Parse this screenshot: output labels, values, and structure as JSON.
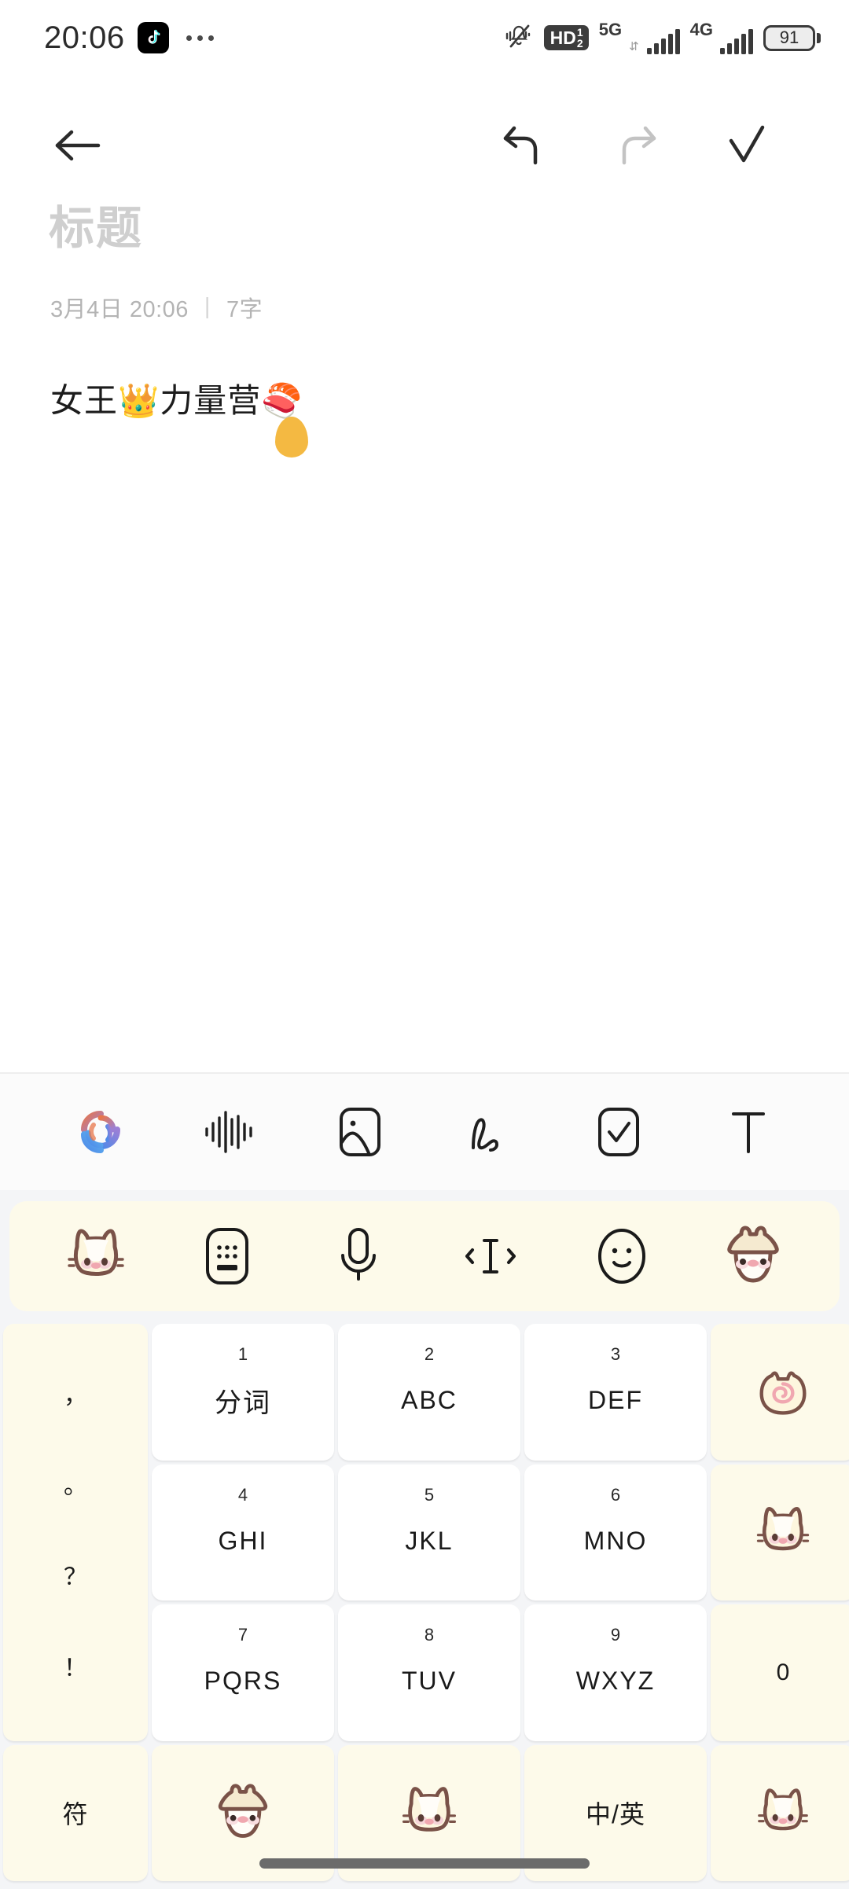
{
  "status_bar": {
    "time": "20:06",
    "app_badge_icon": "tiktok-icon",
    "overflow_icon": "more-dots-icon",
    "mute_icon": "mute-vibrate-icon",
    "hd_label": "HD",
    "hd_sub_top": "1",
    "hd_sub_bottom": "2",
    "network_primary": "5G",
    "network_secondary": "4G",
    "data_arrows_icon": "data-transfer-icon",
    "battery_level": "91"
  },
  "appbar": {
    "back_icon": "back-arrow-icon",
    "undo_icon": "undo-arrow-icon",
    "redo_icon": "redo-arrow-icon",
    "done_icon": "checkmark-icon",
    "undo_enabled": true,
    "redo_enabled": false
  },
  "note": {
    "title_placeholder": "标题",
    "date": "3月4日 20:06",
    "separator": "|",
    "word_count": "7字",
    "body_text": "女王👑力量营🍣"
  },
  "note_tools": [
    {
      "name": "ai-assistant-icon",
      "label": "AI"
    },
    {
      "name": "voice-waveform-icon",
      "label": "语音"
    },
    {
      "name": "image-icon",
      "label": "图片"
    },
    {
      "name": "handwriting-icon",
      "label": "手写"
    },
    {
      "name": "checklist-icon",
      "label": "待办"
    },
    {
      "name": "text-format-icon",
      "label": "T"
    }
  ],
  "keyboard": {
    "toolbar": [
      {
        "name": "mascot-cat-icon"
      },
      {
        "name": "keyboard-switch-icon"
      },
      {
        "name": "microphone-icon"
      },
      {
        "name": "cursor-move-icon"
      },
      {
        "name": "emoji-smiley-icon"
      },
      {
        "name": "mascot-hat-icon"
      }
    ],
    "punctuation_key": [
      "，",
      "。",
      "？",
      "！"
    ],
    "rows": [
      [
        {
          "num": "1",
          "alpha": "分词",
          "type": "cn",
          "key_name": "key-1-fenci"
        },
        {
          "num": "2",
          "alpha": "ABC",
          "type": "alpha",
          "key_name": "key-2-abc"
        },
        {
          "num": "3",
          "alpha": "DEF",
          "type": "alpha",
          "key_name": "key-3-def"
        }
      ],
      [
        {
          "num": "4",
          "alpha": "GHI",
          "type": "alpha",
          "key_name": "key-4-ghi"
        },
        {
          "num": "5",
          "alpha": "JKL",
          "type": "alpha",
          "key_name": "key-5-jkl"
        },
        {
          "num": "6",
          "alpha": "MNO",
          "type": "alpha",
          "key_name": "key-6-mno"
        }
      ],
      [
        {
          "num": "7",
          "alpha": "PQRS",
          "type": "alpha",
          "key_name": "key-7-pqrs"
        },
        {
          "num": "8",
          "alpha": "TUV",
          "type": "alpha",
          "key_name": "key-8-tuv"
        },
        {
          "num": "9",
          "alpha": "WXYZ",
          "type": "alpha",
          "key_name": "key-9-wxyz"
        }
      ]
    ],
    "right_column": [
      {
        "name": "backspace-mascot-icon",
        "label": ""
      },
      {
        "name": "clear-mascot-icon",
        "label": ""
      },
      {
        "name": "key-0",
        "label": "0"
      }
    ],
    "bottom_row": [
      {
        "name": "symbols-key",
        "label": "符"
      },
      {
        "name": "mascot-hat-key",
        "label": ""
      },
      {
        "name": "space-mascot-key",
        "label": ""
      },
      {
        "name": "lang-toggle-key",
        "label": "中/英"
      },
      {
        "name": "enter-mascot-key",
        "label": ""
      }
    ]
  },
  "colors": {
    "keyboard_bg": "#f4f5f7",
    "key_cream": "#fdfaea",
    "key_white": "#ffffff",
    "mascot_outline": "#7a5248",
    "mascot_blush": "#f2c9cb",
    "drop_yellow": "#f4b942"
  },
  "system": {
    "home_indicator": "home-indicator"
  }
}
